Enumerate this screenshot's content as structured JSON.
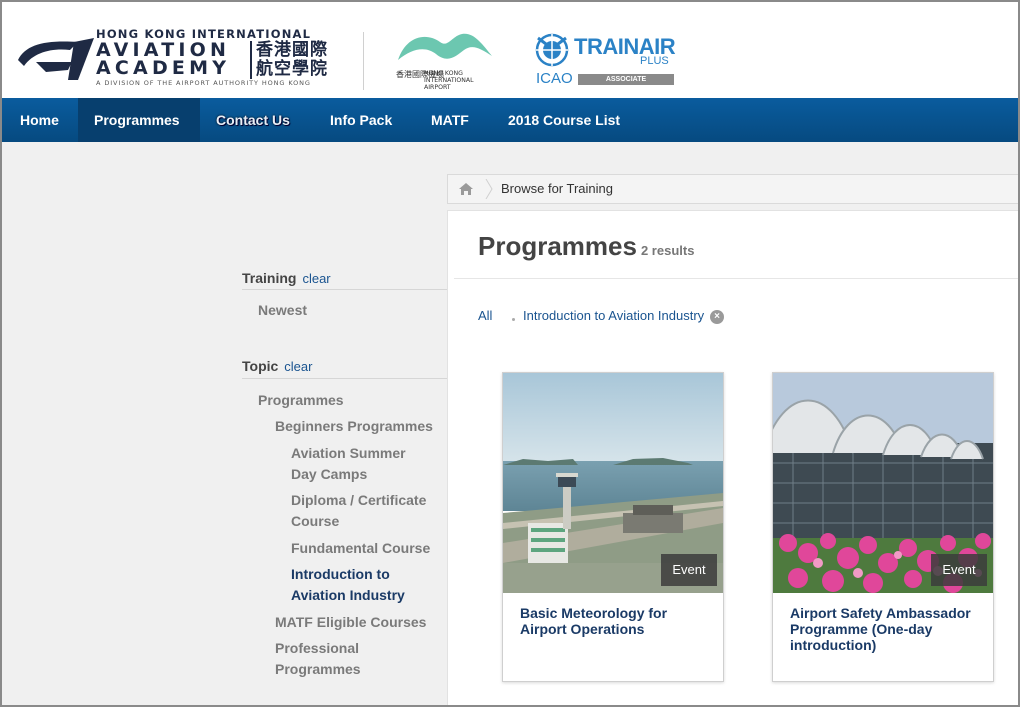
{
  "brand": {
    "academy_line1": "HONG KONG INTERNATIONAL",
    "academy_line2": "AVIATION",
    "academy_line3": "ACADEMY",
    "academy_chinese": "香港國際航空學院",
    "academy_tagline": "A DIVISION OF THE AIRPORT AUTHORITY HONG KONG",
    "airport_chinese": "香港國際機場",
    "airport_english": [
      "HONG KONG",
      "INTERNATIONAL",
      "AIRPORT"
    ],
    "trainair": "TRAINAIR",
    "plus": "PLUS",
    "icao": "ICAO",
    "associate": "ASSOCIATE",
    "navy": "#1f2a44",
    "teal": "#6cc7b0",
    "icao_blue": "#2b82c6"
  },
  "nav": {
    "items": [
      {
        "label": "Home"
      },
      {
        "label": "Programmes"
      },
      {
        "label": "Contact Us"
      },
      {
        "label": "Info Pack"
      },
      {
        "label": "MATF"
      },
      {
        "label": "2018 Course List"
      }
    ],
    "active": "Programmes",
    "bar_color": "#0a5c9e"
  },
  "breadcrumb": {
    "home_icon": "home-icon",
    "current": "Browse for Training"
  },
  "sidebar": {
    "training": {
      "heading": "Training",
      "clear": "clear",
      "items": [
        "Newest"
      ]
    },
    "topic": {
      "heading": "Topic",
      "clear": "clear",
      "items": [
        {
          "label": "Programmes"
        },
        {
          "label": "Beginners Programmes"
        },
        {
          "label": "Aviation Summer Day Camps"
        },
        {
          "label": "Diploma / Certificate Course"
        },
        {
          "label": "Fundamental Course"
        },
        {
          "label": "Introduction to Aviation Industry",
          "selected": true
        },
        {
          "label": "MATF Eligible Courses"
        },
        {
          "label": "Professional Programmes"
        }
      ]
    }
  },
  "main": {
    "title": "Programmes",
    "count": "2 results",
    "filter_all": "All",
    "active_filter": "Introduction to Aviation Industry",
    "cards": [
      {
        "title": "Basic Meteorology for Airport Operations",
        "badge": "Event",
        "image": "control-tower-photo"
      },
      {
        "title": "Airport Safety Ambassador Programme (One-day introduction)",
        "badge": "Event",
        "image": "terminal-flowers-photo"
      }
    ]
  }
}
